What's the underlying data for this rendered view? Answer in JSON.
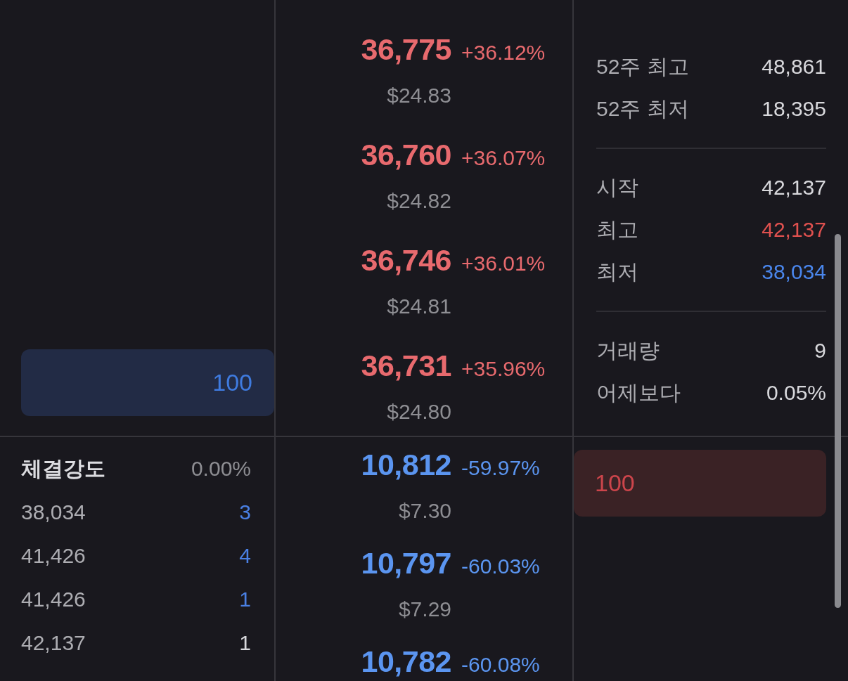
{
  "asks": [
    {
      "price": "36,775",
      "change": "+36.12%",
      "usd": "$24.83"
    },
    {
      "price": "36,760",
      "change": "+36.07%",
      "usd": "$24.82"
    },
    {
      "price": "36,746",
      "change": "+36.01%",
      "usd": "$24.81"
    },
    {
      "price": "36,731",
      "change": "+35.96%",
      "usd": "$24.80",
      "quantity": "100"
    }
  ],
  "stat_groups": [
    {
      "items": [
        {
          "label": "52주 최고",
          "value": "48,861",
          "color": "#d8d8dc"
        },
        {
          "label": "52주 최저",
          "value": "18,395",
          "color": "#d8d8dc"
        }
      ]
    },
    {
      "items": [
        {
          "label": "시작",
          "value": "42,137",
          "color": "#d8d8dc"
        },
        {
          "label": "최고",
          "value": "42,137",
          "color": "#e0514f"
        },
        {
          "label": "최저",
          "value": "38,034",
          "color": "#4a86ec"
        }
      ]
    },
    {
      "items": [
        {
          "label": "거래량",
          "value": "9",
          "color": "#d8d8dc"
        },
        {
          "label": "어제보다",
          "value": "0.05%",
          "color": "#d8d8dc"
        }
      ]
    }
  ],
  "trade_strength": {
    "label": "체결강도",
    "value": "0.00%"
  },
  "trades": [
    {
      "price": "38,034",
      "quantity": "3",
      "color": "#4a80e4"
    },
    {
      "price": "41,426",
      "quantity": "4",
      "color": "#4a80e4"
    },
    {
      "price": "41,426",
      "quantity": "1",
      "color": "#4a80e4"
    },
    {
      "price": "42,137",
      "quantity": "1",
      "color": "#d8d8dc"
    }
  ],
  "bids": [
    {
      "price": "10,812",
      "change": "-59.97%",
      "usd": "$7.30",
      "quantity": "100"
    },
    {
      "price": "10,797",
      "change": "-60.03%",
      "usd": "$7.29"
    },
    {
      "price": "10,782",
      "change": "-60.08%"
    }
  ]
}
